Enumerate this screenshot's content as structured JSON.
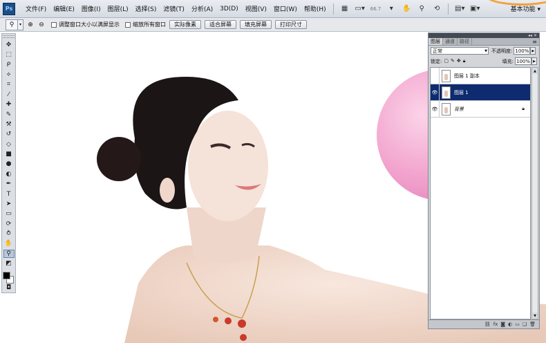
{
  "app": {
    "logo": "Ps"
  },
  "menus": [
    "文件(F)",
    "编辑(E)",
    "图像(I)",
    "图层(L)",
    "选择(S)",
    "滤镜(T)",
    "分析(A)",
    "3D(D)",
    "视图(V)",
    "窗口(W)",
    "帮助(H)"
  ],
  "menubar": {
    "zoom": "66.7",
    "workspace": "基本功能",
    "icons": [
      "bridge-icon",
      "screen-mode-icon",
      "hand-icon",
      "zoom-icon",
      "rotate-icon",
      "arrange-icon",
      "extras-icon"
    ]
  },
  "options": {
    "resize_windows_label": "调整窗口大小以满屏显示",
    "zoom_all_label": "缩放所有窗口",
    "actual_pixels": "实际像素",
    "fit_screen": "适合屏幕",
    "fill_screen": "填充屏幕",
    "print_size": "打印尺寸"
  },
  "tools": [
    "move-tool",
    "marquee-tool",
    "lasso-tool",
    "quick-select-tool",
    "crop-tool",
    "eyedropper-tool",
    "healing-tool",
    "brush-tool",
    "clone-stamp-tool",
    "history-brush-tool",
    "eraser-tool",
    "gradient-tool",
    "blur-tool",
    "dodge-tool",
    "pen-tool",
    "type-tool",
    "path-select-tool",
    "shape-tool",
    "3d-rotate-tool",
    "3d-orbit-tool",
    "hand-tool",
    "zoom-tool"
  ],
  "colors": {
    "foreground": "#000000",
    "background": "#ffffff",
    "selection": "#0d2b6e",
    "balloon": "#f3a8d0"
  },
  "layers_panel": {
    "tabs": [
      "图层",
      "通道",
      "路径"
    ],
    "blend_mode": "正常",
    "opacity_label": "不透明度:",
    "opacity": "100%",
    "lock_label": "锁定:",
    "fill_label": "填充:",
    "fill": "100%",
    "layers": [
      {
        "name": "图层 1 副本",
        "visible": false,
        "selected": false,
        "locked": false
      },
      {
        "name": "图层 1",
        "visible": true,
        "selected": true,
        "locked": false
      },
      {
        "name": "背景",
        "visible": true,
        "selected": false,
        "locked": true
      }
    ],
    "footer_icons": [
      "link-layers-icon",
      "fx-icon",
      "add-mask-icon",
      "adjustment-layer-icon",
      "group-icon",
      "new-layer-icon",
      "delete-layer-icon"
    ]
  }
}
